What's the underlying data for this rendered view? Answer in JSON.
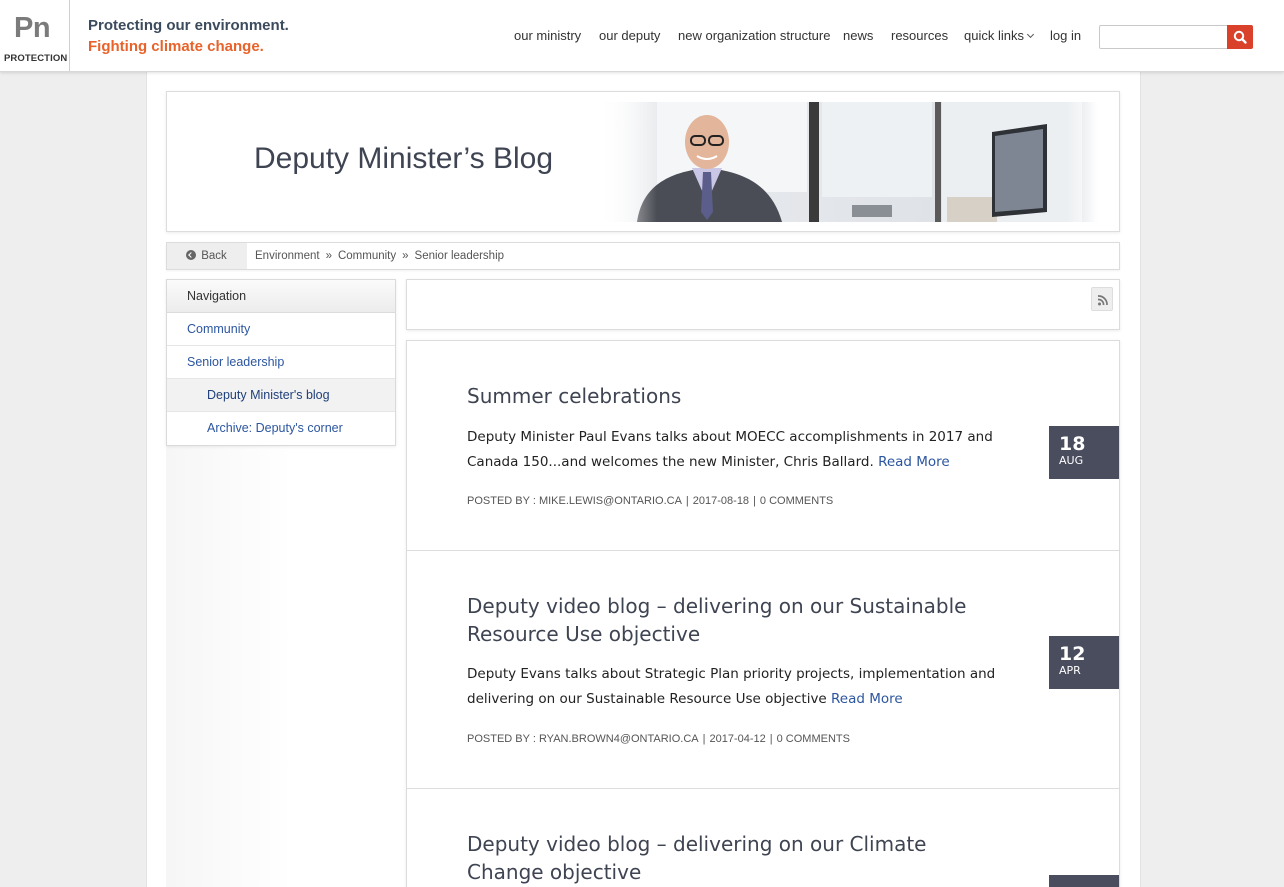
{
  "header": {
    "logo_mark": "Pn",
    "logo_sub": "PROTECTION",
    "tagline_1": "Protecting our environment.",
    "tagline_2": "Fighting climate change.",
    "nav": {
      "our_ministry": "our ministry",
      "our_deputy": "our deputy",
      "new_org": "new organization structure",
      "news": "news",
      "resources": "resources",
      "quick_links": "quick links",
      "log_in": "log in"
    },
    "search_placeholder": "",
    "search_icon": "search-icon"
  },
  "banner": {
    "title": "Deputy Minister’s Blog"
  },
  "breadcrumb": {
    "back_label": "Back",
    "items": [
      "Environment",
      "Community",
      "Senior leadership"
    ],
    "separator": "»"
  },
  "sidebar": {
    "heading": "Navigation",
    "items": [
      {
        "label": "Community"
      },
      {
        "label": "Senior leadership"
      },
      {
        "label": "Deputy Minister's blog"
      },
      {
        "label": "Archive: Deputy's corner"
      }
    ]
  },
  "posts": [
    {
      "title": "Summer celebrations",
      "body": "Deputy Minister Paul Evans talks about MOECC accomplishments in 2017 and Canada 150...and welcomes the new Minister, Chris Ballard.",
      "read_more": "Read More",
      "posted_by_label": "POSTED BY :",
      "author": "MIKE.LEWIS@ONTARIO.CA",
      "date": "2017-08-18",
      "comments": "0 COMMENTS",
      "day": "18",
      "month": "AUG"
    },
    {
      "title": "Deputy video blog – delivering on our Sustainable Resource Use objective",
      "body": "Deputy Evans talks about Strategic Plan priority projects, implementation and delivering on our Sustainable Resource Use objective",
      "read_more": "Read More",
      "posted_by_label": "POSTED BY :",
      "author": "RYAN.BROWN4@ONTARIO.CA",
      "date": "2017-04-12",
      "comments": "0 COMMENTS",
      "day": "12",
      "month": "APR"
    },
    {
      "title": "Deputy video blog – delivering on our Climate Change objective",
      "day": "",
      "month": ""
    }
  ],
  "colors": {
    "accent_orange": "#e8622a",
    "search_red": "#d9412b",
    "link_blue": "#2c56a0",
    "date_box": "#4a4d5e"
  }
}
